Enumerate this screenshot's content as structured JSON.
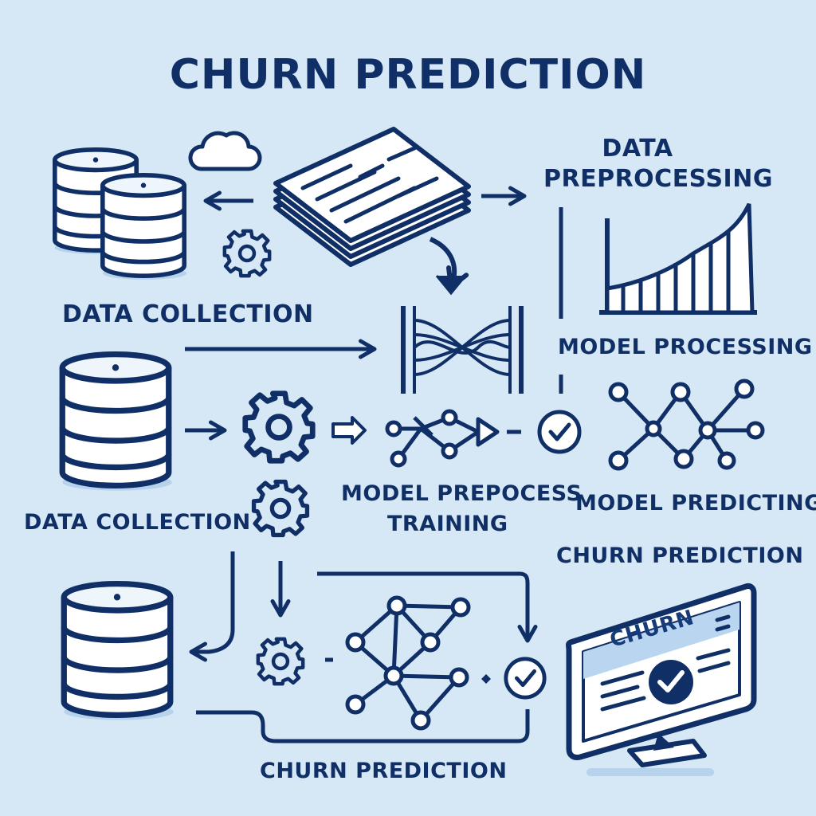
{
  "title": "CHURN PREDICTION",
  "labels": {
    "data_preprocessing_line1": "DATA",
    "data_preprocessing_line2": "PREPROCESSING",
    "data_collection_top": "DATA COLLECTION",
    "model_processing": "MODEL PROCESSING",
    "data_collection_mid": "DATA COLLECTION",
    "model_prepocess": "MODEL PREPOCESS",
    "training": "TRAINING",
    "model_predicting": "MODEL PREDICTING",
    "churn_prediction_right": "CHURN PREDICTION",
    "churn_prediction_bottom": "CHURN PREDICTION"
  },
  "monitor": {
    "header_text": "CHURN"
  },
  "icons": {
    "database": "database-icon",
    "cloud": "cloud-icon",
    "document_stack": "document-stack-icon",
    "gear": "gear-icon",
    "bar_chart": "bar-chart-icon",
    "neural_network": "neural-network-icon",
    "network_graph": "network-graph-icon",
    "check_circle": "check-circle-icon",
    "monitor": "monitor-icon",
    "arrow": "arrow-icon"
  },
  "colors": {
    "background": "#d6e8f5",
    "stroke": "#0f2f66",
    "fill_light": "#ffffff",
    "fill_accent": "#bcd6ee"
  }
}
